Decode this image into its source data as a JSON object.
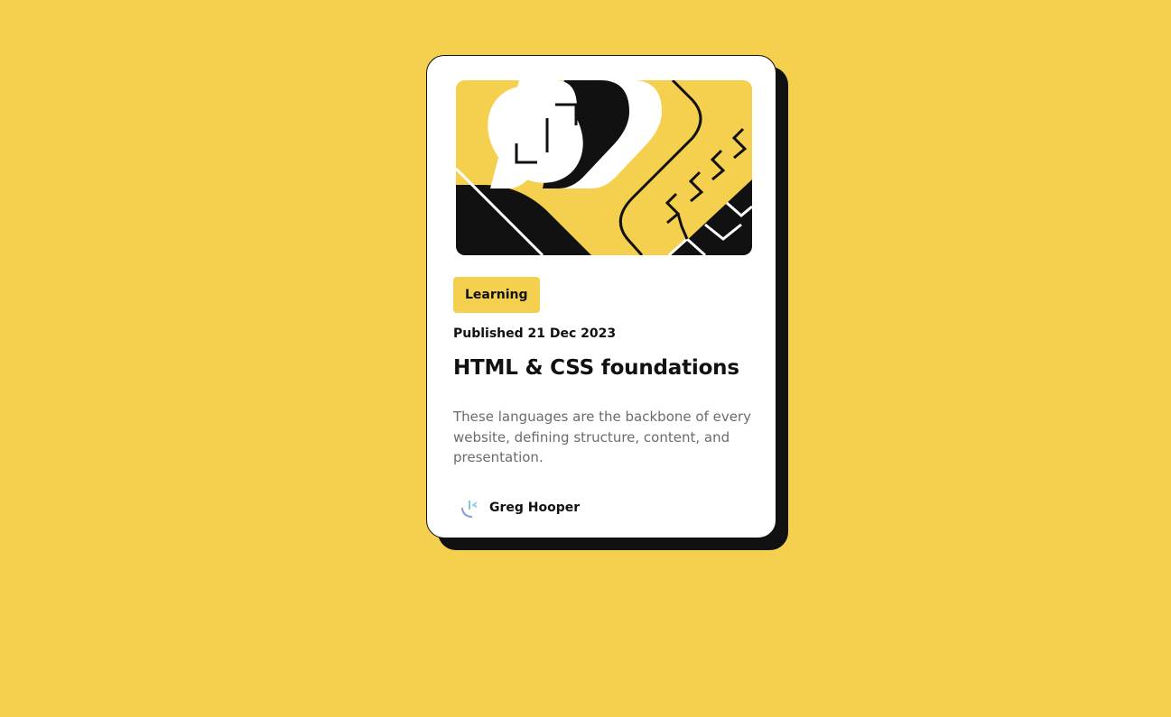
{
  "card": {
    "tag": "Learning",
    "published": "Published 21 Dec 2023",
    "title": "HTML & CSS foundations",
    "description": "These languages are the backbone of every website, defining structure, content, and presentation.",
    "author": {
      "name": "Greg Hooper",
      "avatar_icon": "avatar-image"
    },
    "hero_icon": "code-illustration"
  },
  "colors": {
    "background": "#f4d04e",
    "card": "#ffffff",
    "ink": "#111111",
    "muted_text": "#6b6b6b"
  }
}
